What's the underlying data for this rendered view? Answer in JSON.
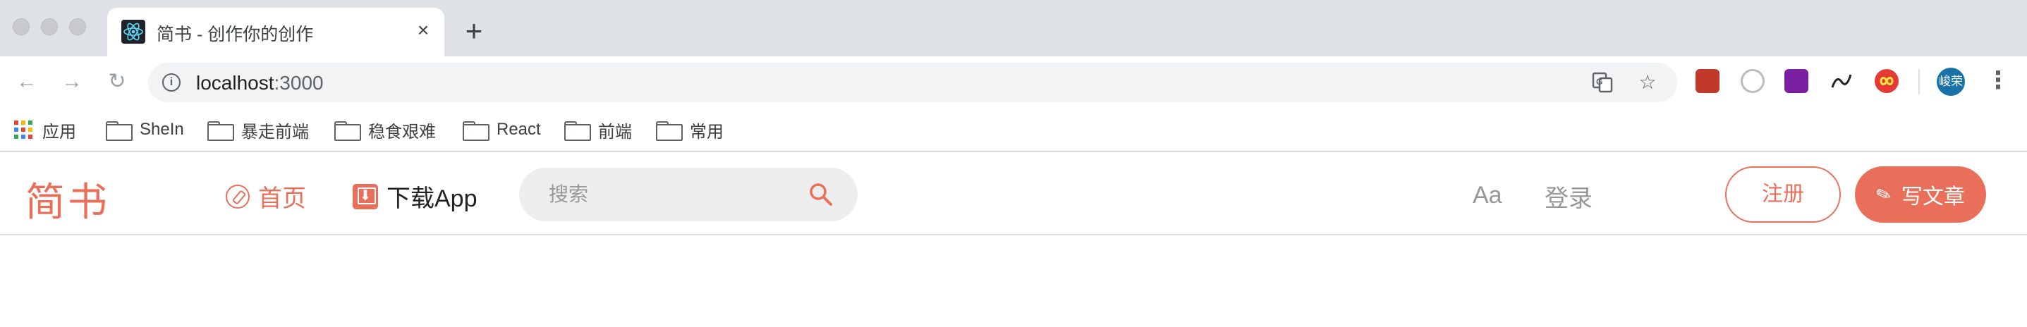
{
  "browser": {
    "tab": {
      "title": "简书 - 创作你的创作",
      "close": "×",
      "favicon": "react-logo-icon"
    },
    "new_tab": "+",
    "nav": {
      "back": "←",
      "forward": "→",
      "reload": "↻"
    },
    "url": {
      "host": "localhost",
      "port": ":3000"
    },
    "omnibox_icons": {
      "translate": "G",
      "bookmark_star": "☆"
    },
    "profile_initials": "峻荣",
    "menu": "⋮",
    "bookmarks": [
      {
        "label": "应用",
        "icon": "apps-grid-icon"
      },
      {
        "label": "SheIn",
        "icon": "folder-icon"
      },
      {
        "label": "暴走前端",
        "icon": "folder-icon"
      },
      {
        "label": "稳食艰难",
        "icon": "folder-icon"
      },
      {
        "label": "React",
        "icon": "folder-icon"
      },
      {
        "label": "前端",
        "icon": "folder-icon"
      },
      {
        "label": "常用",
        "icon": "folder-icon"
      }
    ]
  },
  "site": {
    "logo": "简书",
    "nav_home": "首页",
    "nav_app": "下载App",
    "search_placeholder": "搜索",
    "font_toggle": "Aa",
    "login": "登录",
    "register": "注册",
    "write": "写文章",
    "accent_color": "#ea6f5a"
  }
}
